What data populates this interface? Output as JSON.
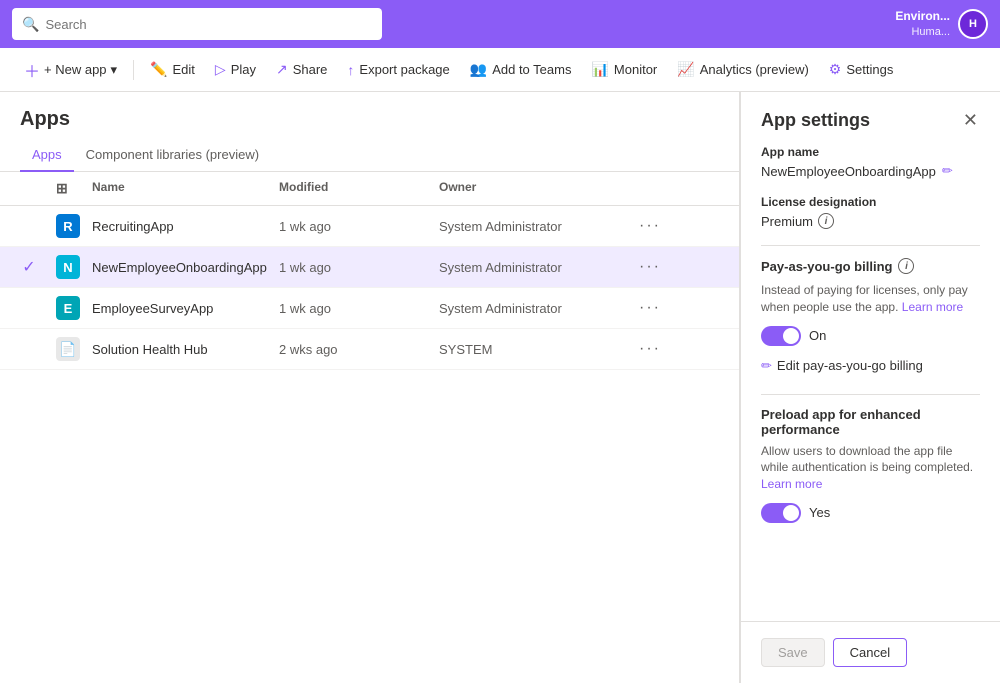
{
  "topbar": {
    "search_placeholder": "Search",
    "env_name": "Environ...",
    "env_user": "Huma...",
    "avatar_initials": "H"
  },
  "toolbar": {
    "new_app_label": "+ New app",
    "new_app_arrow": "▾",
    "edit_label": "Edit",
    "play_label": "Play",
    "share_label": "Share",
    "export_label": "Export package",
    "add_teams_label": "Add to Teams",
    "monitor_label": "Monitor",
    "analytics_label": "Analytics (preview)",
    "settings_label": "Settings"
  },
  "page": {
    "title": "Apps",
    "tabs": [
      {
        "label": "Apps",
        "active": true
      },
      {
        "label": "Component libraries (preview)",
        "active": false
      }
    ]
  },
  "table": {
    "columns": [
      "",
      "",
      "Name",
      "Modified",
      "Owner",
      ""
    ],
    "rows": [
      {
        "name": "RecruitingApp",
        "modified": "1 wk ago",
        "owner": "System Administrator",
        "icon_type": "blue",
        "icon_letter": "R",
        "selected": false
      },
      {
        "name": "NewEmployeeOnboardingApp",
        "modified": "1 wk ago",
        "owner": "System Administrator",
        "icon_type": "teal",
        "icon_letter": "N",
        "selected": true
      },
      {
        "name": "EmployeeSurveyApp",
        "modified": "1 wk ago",
        "owner": "System Administrator",
        "icon_type": "green",
        "icon_letter": "E",
        "selected": false
      },
      {
        "name": "Solution Health Hub",
        "modified": "2 wks ago",
        "owner": "SYSTEM",
        "icon_type": "doc",
        "icon_letter": "📄",
        "selected": false
      }
    ]
  },
  "app_settings": {
    "title": "App settings",
    "app_name_label": "App name",
    "app_name_value": "NewEmployeeOnboardingApp",
    "license_label": "License designation",
    "license_value": "Premium",
    "billing_title": "Pay-as-you-go billing",
    "billing_desc": "Instead of paying for licenses, only pay when people use the app.",
    "billing_learn_more": "Learn more",
    "billing_toggle_label": "On",
    "edit_billing_label": "Edit pay-as-you-go billing",
    "preload_title": "Preload app for enhanced performance",
    "preload_desc": "Allow users to download the app file while authentication is being completed.",
    "preload_learn_more": "Learn more",
    "preload_toggle_label": "Yes",
    "save_label": "Save",
    "cancel_label": "Cancel"
  }
}
